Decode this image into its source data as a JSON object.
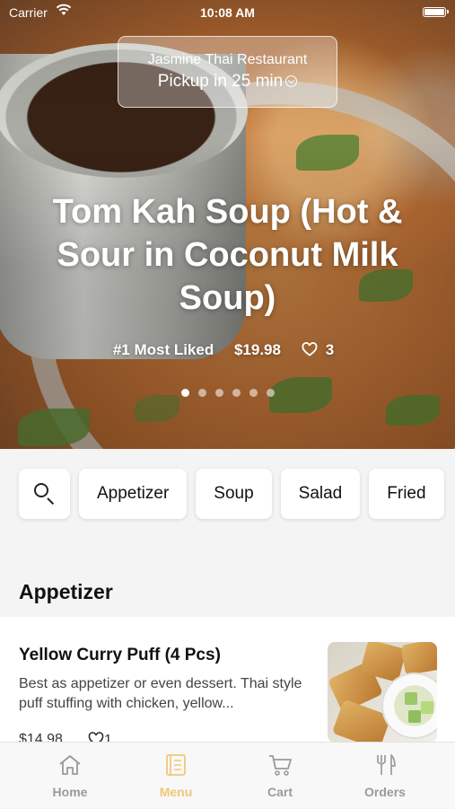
{
  "status_bar": {
    "carrier": "Carrier",
    "time": "10:08 AM"
  },
  "restaurant": {
    "name": "Jasmine Thai Restaurant",
    "pickup": "Pickup in 25 min"
  },
  "featured": {
    "title": "Tom Kah Soup (Hot & Sour in Coconut Milk Soup)",
    "badge": "#1 Most Liked",
    "price": "$19.98",
    "likes": "3",
    "carousel_pages": 6,
    "carousel_current": 1
  },
  "categories": [
    {
      "label": "Appetizer"
    },
    {
      "label": "Soup"
    },
    {
      "label": "Salad"
    },
    {
      "label": "Fried"
    }
  ],
  "section": {
    "title": "Appetizer"
  },
  "items": [
    {
      "name": "Yellow Curry Puff (4 Pcs)",
      "description": "Best as appetizer or even dessert. Thai style puff stuffing with chicken, yellow...",
      "price": "$14.98",
      "likes": "1"
    }
  ],
  "tabs": [
    {
      "label": "Home",
      "icon": "home-icon"
    },
    {
      "label": "Menu",
      "icon": "menu-icon",
      "active": true
    },
    {
      "label": "Cart",
      "icon": "cart-icon"
    },
    {
      "label": "Orders",
      "icon": "utensils-icon"
    }
  ],
  "colors": {
    "accent": "#f0c777",
    "inactive": "#9a9a9a"
  }
}
